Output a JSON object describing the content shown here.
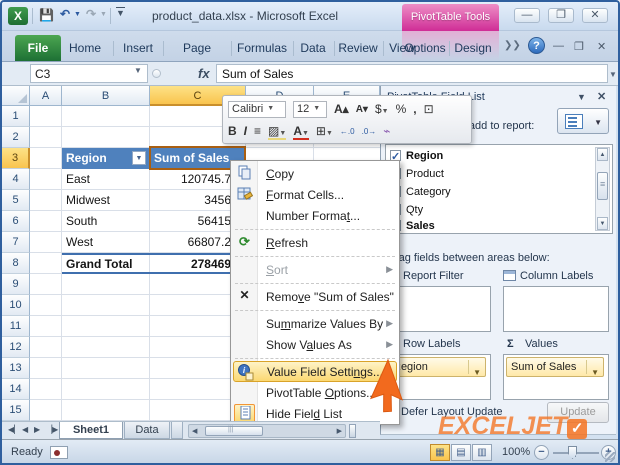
{
  "colors": {
    "contextual_tab_pink": "#cf2d96",
    "file_tab_green": "#217346",
    "pivot_header_blue": "#4f81bd",
    "selection_amber": "#f9c44e",
    "menu_highlight_orange": "#d9a32a",
    "logo_orange": "#f47321"
  },
  "titlebar": {
    "title": "product_data.xlsx - Microsoft Excel",
    "contextual_tab": "PivotTable Tools",
    "excel_icon": "X"
  },
  "ribbon": {
    "file_tab": "File",
    "tabs": [
      "Home",
      "Insert",
      "Page Layou",
      "Formulas",
      "Data",
      "Review",
      "View",
      "Options",
      "Design"
    ]
  },
  "formula_bar": {
    "name_box": "C3",
    "fx": "fx",
    "formula": "Sum of Sales"
  },
  "sheet": {
    "columns": [
      "A",
      "B",
      "C",
      "D",
      "E"
    ],
    "row_numbers": [
      "1",
      "2",
      "3",
      "4",
      "5",
      "6",
      "7",
      "8",
      "9",
      "10",
      "11",
      "12",
      "13",
      "14",
      "15"
    ],
    "selected_cell": "C3"
  },
  "pivot": {
    "header_region": "Region",
    "header_value": "Sum of Sales",
    "rows": [
      {
        "region": "East",
        "value": "120745.7"
      },
      {
        "region": "Midwest",
        "value": "3456"
      },
      {
        "region": "South",
        "value": "56415"
      },
      {
        "region": "West",
        "value": "66807.2"
      }
    ],
    "total_label": "Grand Total",
    "total_value": "278469"
  },
  "mini_toolbar": {
    "font_name": "Calibri",
    "font_size": "12",
    "bold": "B",
    "italic": "I"
  },
  "context_menu": {
    "items": [
      {
        "pre": "",
        "key": "C",
        "post": "opy"
      },
      {
        "pre": "",
        "key": "F",
        "post": "ormat Cells..."
      },
      {
        "pre": "Number Forma",
        "key": "t",
        "post": "..."
      },
      {
        "pre": "",
        "key": "R",
        "post": "efresh"
      },
      {
        "pre": "",
        "key": "S",
        "post": "ort",
        "disabled": true,
        "submenu": true
      },
      {
        "pre": "Remo",
        "key": "v",
        "post": "e \"Sum of Sales\""
      },
      {
        "pre": "Su",
        "key": "m",
        "post": "marize Values By",
        "submenu": true
      },
      {
        "pre": "Show V",
        "key": "a",
        "post": "lues As",
        "submenu": true
      },
      {
        "pre": "Value Field Setti",
        "key": "n",
        "post": "gs...",
        "highlighted": true
      },
      {
        "pre": "PivotTable ",
        "key": "O",
        "post": "ptions..."
      },
      {
        "pre": "Hide Fiel",
        "key": "d",
        "post": " List"
      }
    ]
  },
  "field_list": {
    "title": "PivotTable Field List",
    "choose_label": "Choose fields to add to report:",
    "fields": [
      {
        "label": "Region",
        "checked": true,
        "bold": true
      },
      {
        "label": "Product",
        "checked": false,
        "bold": false
      },
      {
        "label": "Category",
        "checked": false,
        "bold": false
      },
      {
        "label": "Qty",
        "checked": false,
        "bold": false
      },
      {
        "label": "Sales",
        "checked": true,
        "bold": true
      }
    ],
    "drag_label": "Drag fields between areas below:",
    "areas": {
      "report_filter": "Report Filter",
      "column_labels": "Column Labels",
      "row_labels": "Row Labels",
      "values_sigma": "Σ",
      "values": "Values",
      "row_pill": "Region",
      "values_pill": "Sum of Sales"
    },
    "defer_label": "Defer Layout Update",
    "update_button": "Update"
  },
  "sheet_tabs": {
    "tabs": [
      "Sheet1",
      "Data"
    ]
  },
  "status_bar": {
    "ready": "Ready",
    "zoom": "100%"
  },
  "logo": {
    "text": "EXCELJET",
    "mark": "✓"
  }
}
